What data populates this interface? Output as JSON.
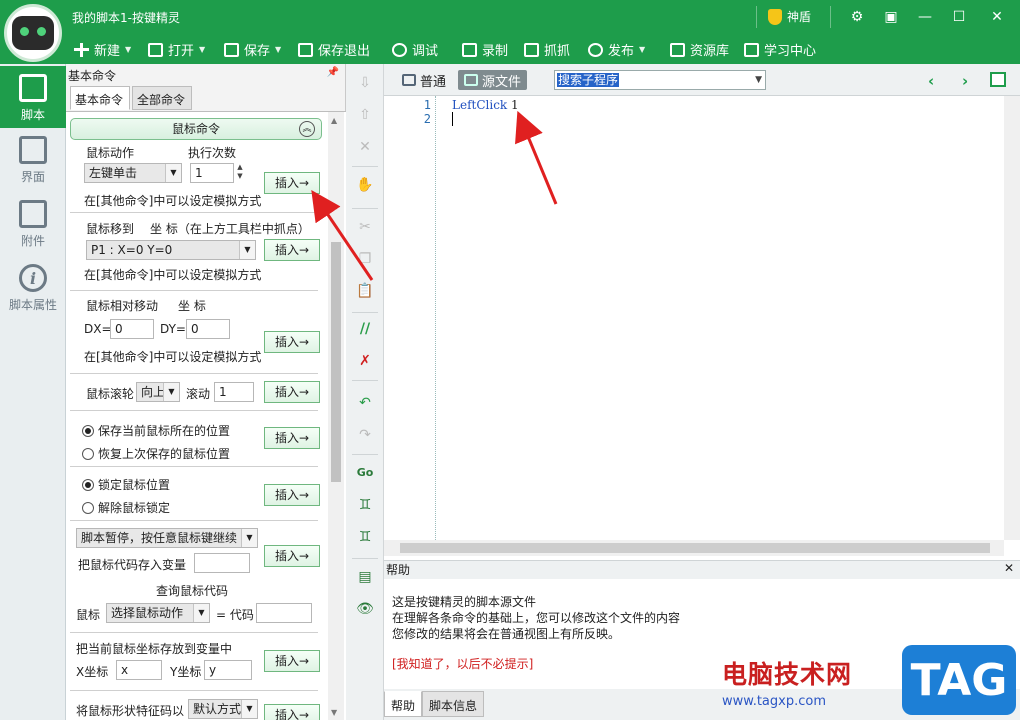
{
  "app": {
    "title": "我的脚本1-按键精灵",
    "shield_label": "神盾"
  },
  "menu": [
    {
      "label": "新建",
      "icon": "plus-icon",
      "dropdown": true
    },
    {
      "label": "打开",
      "icon": "folder-icon",
      "dropdown": true
    },
    {
      "label": "保存",
      "icon": "save-icon",
      "dropdown": true
    },
    {
      "label": "保存退出",
      "icon": "save-exit-icon"
    },
    {
      "label": "调试",
      "icon": "play-icon"
    },
    {
      "label": "录制",
      "icon": "camera-icon"
    },
    {
      "label": "抓抓",
      "icon": "screenshot-icon"
    },
    {
      "label": "发布",
      "icon": "publish-icon",
      "dropdown": true
    },
    {
      "label": "资源库",
      "icon": "plus-box-icon"
    },
    {
      "label": "学习中心",
      "icon": "book-icon"
    }
  ],
  "leftnav": [
    {
      "label": "脚本",
      "icon": "script-icon",
      "active": true
    },
    {
      "label": "界面",
      "icon": "ui-grid-icon"
    },
    {
      "label": "附件",
      "icon": "attachment-icon"
    },
    {
      "label": "脚本属性",
      "icon": "info-icon"
    }
  ],
  "cmdpanel": {
    "title": "基本命令",
    "tabs": [
      "基本命令",
      "全部命令"
    ],
    "group_title": "鼠标命令",
    "insert_label": "插入→",
    "mouse_action": {
      "label": "鼠标动作",
      "times_label": "执行次数",
      "action_value": "左键单击",
      "times_value": "1",
      "note": "在[其他命令]中可以设定模拟方式"
    },
    "mouse_move": {
      "label": "鼠标移到",
      "coord_label": "坐 标（在上方工具栏中抓点）",
      "value": "P1 : X=0 Y=0",
      "note": "在[其他命令]中可以设定模拟方式"
    },
    "mouse_rel": {
      "label": "鼠标相对移动",
      "coord_label": "坐 标",
      "dx_label": "DX=",
      "dx_value": "0",
      "dy_label": "DY=",
      "dy_value": "0",
      "note": "在[其他命令]中可以设定模拟方式"
    },
    "wheel": {
      "label": "鼠标滚轮",
      "dir_value": "向上",
      "scroll_label": "滚动",
      "scroll_value": "1"
    },
    "save_pos": {
      "opt1": "保存当前鼠标所在的位置",
      "opt2": "恢复上次保存的鼠标位置"
    },
    "lock": {
      "opt1": "锁定鼠标位置",
      "opt2": "解除鼠标锁定"
    },
    "pause": {
      "value": "脚本暂停，按任意鼠标键继续",
      "store_label": "把鼠标代码存入变量"
    },
    "query": {
      "title": "查询鼠标代码",
      "label": "鼠标",
      "value": "选择鼠标动作",
      "eq_label": "= 代码"
    },
    "store_pos": {
      "title": "把当前鼠标坐标存放到变量中",
      "x_label": "X坐标",
      "x_value": "x",
      "y_label": "Y坐标",
      "y_value": "y"
    },
    "shape": {
      "label": "将鼠标形状特征码以",
      "value": "默认方式"
    }
  },
  "editor": {
    "tab_normal": "普通",
    "tab_source": "源文件",
    "sub_combo": "搜索子程序",
    "line_numbers": [
      "1",
      "2"
    ],
    "code_keyword": "LeftClick",
    "code_arg": "1"
  },
  "help": {
    "title": "帮助",
    "lines": [
      "这是按键精灵的脚本源文件",
      "在理解各条命令的基础上，您可以修改这个文件的内容",
      "您修改的结果将会在普通视图上有所反映。"
    ],
    "dismiss": "[我知道了，以后不必提示]",
    "tabs": [
      "帮助",
      "脚本信息"
    ]
  },
  "watermark": {
    "cn": "电脑技术网",
    "url": "www.tagxp.com",
    "tag": "TAG"
  },
  "colors": {
    "brand": "#1e9d4b",
    "annotation_arrow": "#e02020"
  }
}
